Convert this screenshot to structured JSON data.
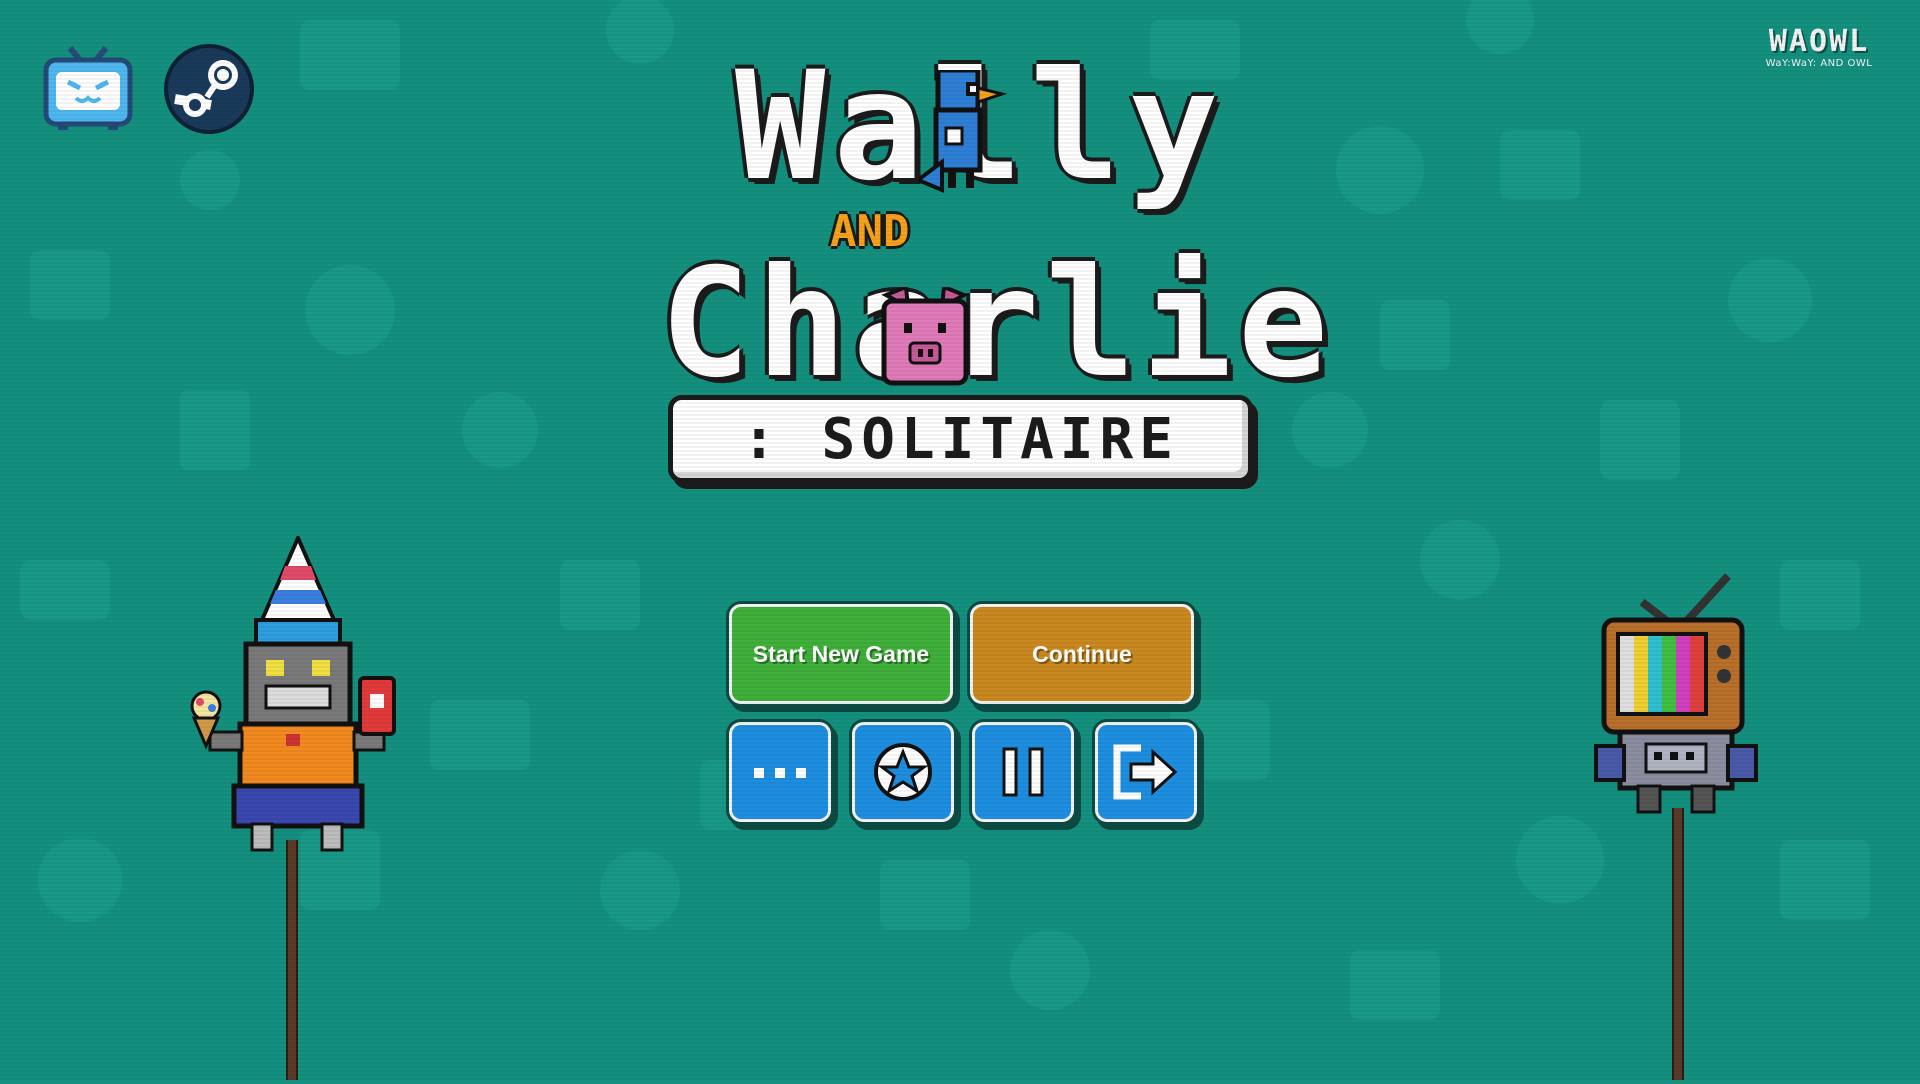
{
  "game": {
    "title_line1": "Wally",
    "title_and": "AND",
    "title_line2": "Charlie",
    "subtitle": ": SOLITAIRE"
  },
  "studio_logo": {
    "name": "WAOWL",
    "tagline": "WaY:WaY: AND OWL"
  },
  "menu": {
    "start_label": "Start New Game",
    "continue_label": "Continue",
    "icon_buttons": [
      "more-icon",
      "star-icon",
      "pause-icon",
      "exit-icon"
    ]
  },
  "corner_icons": [
    "bilibili-icon",
    "steam-icon"
  ],
  "colors": {
    "background": "#14907f",
    "start_button": "#3fb03a",
    "continue_button": "#c9891f",
    "icon_button": "#1e8ee0"
  }
}
